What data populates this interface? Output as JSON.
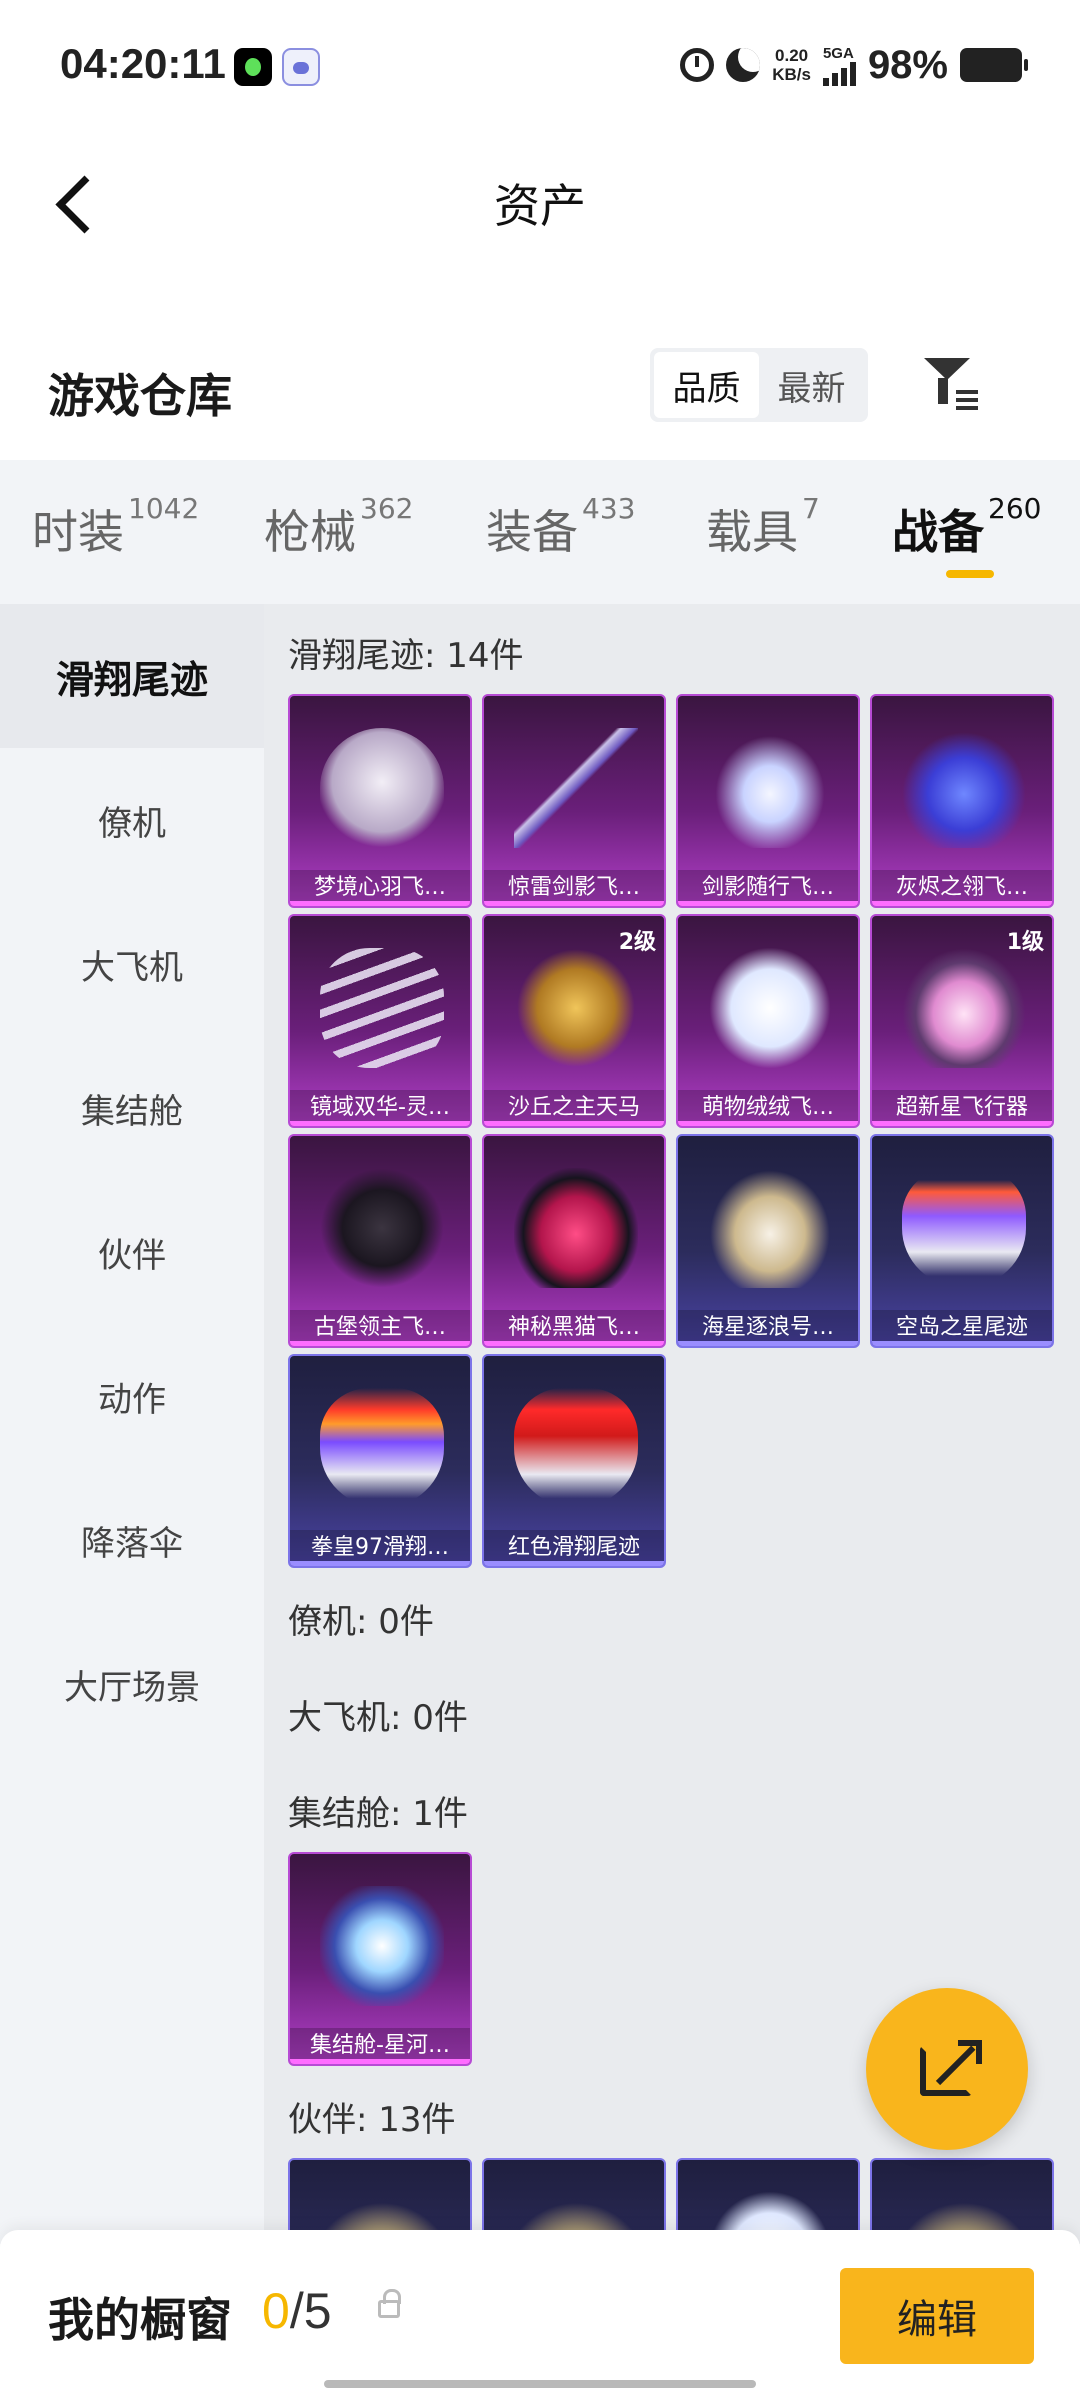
{
  "status_bar": {
    "time": "04:20:11",
    "net_speed": "0.20",
    "net_unit": "KB/s",
    "signal": "5GA",
    "battery": "98%"
  },
  "header": {
    "title": "资产"
  },
  "section": {
    "title": "游戏仓库",
    "sort_options": [
      "品质",
      "最新"
    ],
    "sort_selected": "品质"
  },
  "tabs": [
    {
      "label": "时装",
      "count": "1042"
    },
    {
      "label": "枪械",
      "count": "362"
    },
    {
      "label": "装备",
      "count": "433"
    },
    {
      "label": "载具",
      "count": "7"
    },
    {
      "label": "战备",
      "count": "260",
      "active": true
    }
  ],
  "rail": [
    {
      "label": "滑翔尾迹",
      "active": true
    },
    {
      "label": "僚机"
    },
    {
      "label": "大飞机"
    },
    {
      "label": "集结舱"
    },
    {
      "label": "伙伴"
    },
    {
      "label": "动作"
    },
    {
      "label": "降落伞"
    },
    {
      "label": "大厅场景"
    }
  ],
  "groups": [
    {
      "title": "滑翔尾迹: 14件",
      "items": [
        {
          "name": "梦境心羽飞…",
          "rarity": "epic",
          "art": "a"
        },
        {
          "name": "惊雷剑影飞…",
          "rarity": "epic",
          "art": "b"
        },
        {
          "name": "剑影随行飞…",
          "rarity": "epic",
          "art": "c"
        },
        {
          "name": "灰烬之翎飞…",
          "rarity": "epic",
          "art": "d"
        },
        {
          "name": "镜域双华-灵…",
          "rarity": "epic",
          "art": "e"
        },
        {
          "name": "沙丘之主天马",
          "rarity": "epic",
          "art": "f",
          "level": "2级"
        },
        {
          "name": "萌物绒绒飞…",
          "rarity": "epic",
          "art": "g"
        },
        {
          "name": "超新星飞行器",
          "rarity": "epic",
          "art": "h",
          "level": "1级"
        },
        {
          "name": "古堡领主飞…",
          "rarity": "epic",
          "art": "i"
        },
        {
          "name": "神秘黑猫飞…",
          "rarity": "epic",
          "art": "j"
        },
        {
          "name": "海星逐浪号…",
          "rarity": "rare",
          "art": "k"
        },
        {
          "name": "空岛之星尾迹",
          "rarity": "rare",
          "art": "l"
        },
        {
          "name": "拳皇97滑翔…",
          "rarity": "rare",
          "art": "m"
        },
        {
          "name": "红色滑翔尾迹",
          "rarity": "rare",
          "art": "n"
        }
      ]
    },
    {
      "title": "僚机: 0件",
      "items": []
    },
    {
      "title": "大飞机: 0件",
      "items": []
    },
    {
      "title": "集结舱: 1件",
      "items": [
        {
          "name": "集结舱-星河…",
          "rarity": "epic",
          "art": "o"
        }
      ]
    },
    {
      "title": "伙伴: 13件",
      "items": [
        {
          "name": "",
          "rarity": "rare",
          "art": "p"
        },
        {
          "name": "",
          "rarity": "rare",
          "art": "p"
        },
        {
          "name": "",
          "rarity": "rare",
          "art": "g"
        },
        {
          "name": "",
          "rarity": "rare",
          "art": "p"
        }
      ]
    }
  ],
  "bottom": {
    "label": "我的橱窗",
    "current": "0",
    "total": "/5",
    "edit": "编辑"
  },
  "colors": {
    "accent": "#f9b51c",
    "epic": "#b74bd4",
    "rare": "#7c74e8"
  }
}
